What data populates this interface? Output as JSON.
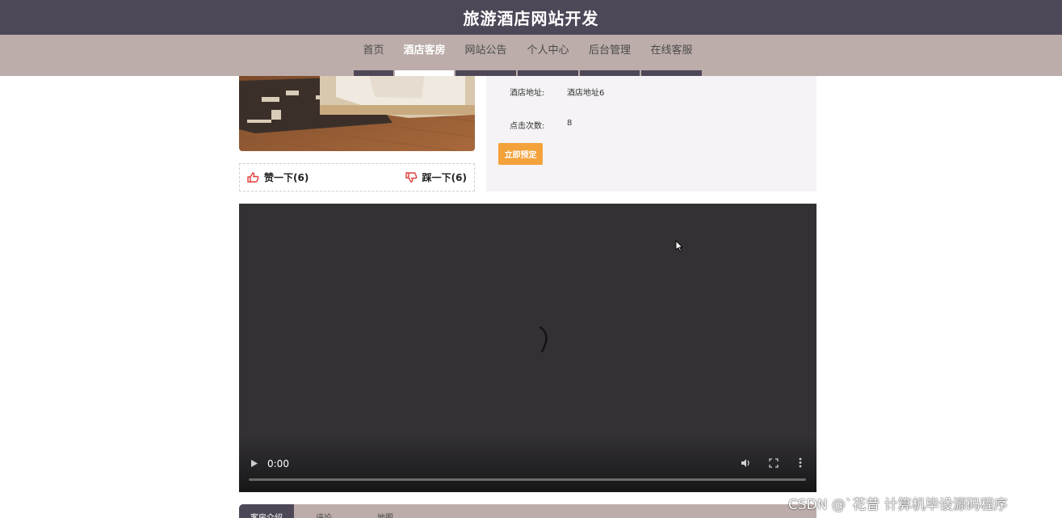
{
  "header": {
    "title": "旅游酒店网站开发"
  },
  "nav": {
    "items": [
      {
        "label": "首页",
        "active": false
      },
      {
        "label": "酒店客房",
        "active": true
      },
      {
        "label": "网站公告",
        "active": false
      },
      {
        "label": "个人中心",
        "active": false
      },
      {
        "label": "后台管理",
        "active": false
      },
      {
        "label": "在线客服",
        "active": false
      }
    ]
  },
  "room": {
    "like_label": "赞一下(6)",
    "dislike_label": "踩一下(6)",
    "info": [
      {
        "key": "酒店地址:",
        "value": "酒店地址6"
      },
      {
        "key": "点击次数:",
        "value": "8"
      }
    ],
    "book_label": "立即预定"
  },
  "video": {
    "time": "0:00",
    "progress": 0
  },
  "tabs": [
    {
      "label": "客房介绍",
      "active": true
    },
    {
      "label": "评论",
      "active": false
    },
    {
      "label": "地图",
      "active": false
    }
  ],
  "watermark": "CSDN @ˋ花昔  计算机毕设源码程序",
  "colors": {
    "header_bg": "#4e4758",
    "nav_bg": "#bcadaa",
    "accent_button": "#f3a23b",
    "video_bg": "#333134",
    "info_panel_bg": "#f5f3f5"
  }
}
